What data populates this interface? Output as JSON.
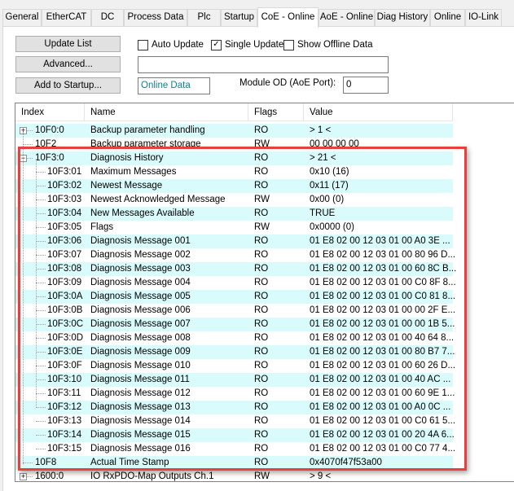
{
  "tabs": [
    {
      "label": "General",
      "active": false
    },
    {
      "label": "EtherCAT",
      "active": false
    },
    {
      "label": "DC",
      "active": false
    },
    {
      "label": "Process Data",
      "active": false
    },
    {
      "label": "Plc",
      "active": false
    },
    {
      "label": "Startup",
      "active": false
    },
    {
      "label": "CoE - Online",
      "active": true
    },
    {
      "label": "AoE - Online",
      "active": false
    },
    {
      "label": "Diag History",
      "active": false
    },
    {
      "label": "Online",
      "active": false
    },
    {
      "label": "IO-Link",
      "active": false
    }
  ],
  "toolbar": {
    "update_list": "Update List",
    "advanced": "Advanced...",
    "add_to_startup": "Add to Startup...",
    "auto_update": {
      "label": "Auto Update",
      "checked": false
    },
    "single_update": {
      "label": "Single Update",
      "checked": true
    },
    "show_offline": {
      "label": "Show Offline Data",
      "checked": false
    },
    "filter_value": "",
    "data_source": "Online Data",
    "module_od_label": "Module OD (AoE Port):",
    "module_od_value": "0"
  },
  "table": {
    "columns": [
      "Index",
      "Name",
      "Flags",
      "Value"
    ],
    "rows": [
      {
        "index": "10F0:0",
        "name": "Backup parameter handling",
        "flags": "RO",
        "value": "> 1 <",
        "level": 0,
        "expander": "+"
      },
      {
        "index": "10F2",
        "name": "Backup parameter storage",
        "flags": "RW",
        "value": "00 00 00 00",
        "level": 0,
        "expander": ""
      },
      {
        "index": "10F3:0",
        "name": "Diagnosis History",
        "flags": "RO",
        "value": "> 21 <",
        "level": 0,
        "expander": "-"
      },
      {
        "index": "10F3:01",
        "name": "Maximum Messages",
        "flags": "RO",
        "value": "0x10 (16)",
        "level": 1,
        "expander": ""
      },
      {
        "index": "10F3:02",
        "name": "Newest Message",
        "flags": "RO",
        "value": "0x11 (17)",
        "level": 1,
        "expander": ""
      },
      {
        "index": "10F3:03",
        "name": "Newest Acknowledged Message",
        "flags": "RW",
        "value": "0x00 (0)",
        "level": 1,
        "expander": ""
      },
      {
        "index": "10F3:04",
        "name": "New Messages Available",
        "flags": "RO",
        "value": "TRUE",
        "level": 1,
        "expander": ""
      },
      {
        "index": "10F3:05",
        "name": "Flags",
        "flags": "RW",
        "value": "0x0000 (0)",
        "level": 1,
        "expander": ""
      },
      {
        "index": "10F3:06",
        "name": "Diagnosis Message 001",
        "flags": "RO",
        "value": "01 E8 02 00 12 03 01 00 A0 3E ...",
        "level": 1,
        "expander": ""
      },
      {
        "index": "10F3:07",
        "name": "Diagnosis Message 002",
        "flags": "RO",
        "value": "01 E8 02 00 12 03 01 00 80 96 D...",
        "level": 1,
        "expander": ""
      },
      {
        "index": "10F3:08",
        "name": "Diagnosis Message 003",
        "flags": "RO",
        "value": "01 E8 02 00 12 03 01 00 60 8C B...",
        "level": 1,
        "expander": ""
      },
      {
        "index": "10F3:09",
        "name": "Diagnosis Message 004",
        "flags": "RO",
        "value": "01 E8 02 00 12 03 01 00 C0 8F 8...",
        "level": 1,
        "expander": ""
      },
      {
        "index": "10F3:0A",
        "name": "Diagnosis Message 005",
        "flags": "RO",
        "value": "01 E8 02 00 12 03 01 00 C0 81 8...",
        "level": 1,
        "expander": ""
      },
      {
        "index": "10F3:0B",
        "name": "Diagnosis Message 006",
        "flags": "RO",
        "value": "01 E8 02 00 12 03 01 00 00 2F E...",
        "level": 1,
        "expander": ""
      },
      {
        "index": "10F3:0C",
        "name": "Diagnosis Message 007",
        "flags": "RO",
        "value": "01 E8 02 00 12 03 01 00 00 1B 5...",
        "level": 1,
        "expander": ""
      },
      {
        "index": "10F3:0D",
        "name": "Diagnosis Message 008",
        "flags": "RO",
        "value": "01 E8 02 00 12 03 01 00 40 64 8...",
        "level": 1,
        "expander": ""
      },
      {
        "index": "10F3:0E",
        "name": "Diagnosis Message 009",
        "flags": "RO",
        "value": "01 E8 02 00 12 03 01 00 80 B7 7...",
        "level": 1,
        "expander": ""
      },
      {
        "index": "10F3:0F",
        "name": "Diagnosis Message 010",
        "flags": "RO",
        "value": "01 E8 02 00 12 03 01 00 60 26 D...",
        "level": 1,
        "expander": ""
      },
      {
        "index": "10F3:10",
        "name": "Diagnosis Message 011",
        "flags": "RO",
        "value": "01 E8 02 00 12 03 01 00 40 AC ...",
        "level": 1,
        "expander": ""
      },
      {
        "index": "10F3:11",
        "name": "Diagnosis Message 012",
        "flags": "RO",
        "value": "01 E8 02 00 12 03 01 00 60 9E 1...",
        "level": 1,
        "expander": ""
      },
      {
        "index": "10F3:12",
        "name": "Diagnosis Message 013",
        "flags": "RO",
        "value": "01 E8 02 00 12 03 01 00 A0 0C ...",
        "level": 1,
        "expander": ""
      },
      {
        "index": "10F3:13",
        "name": "Diagnosis Message 014",
        "flags": "RO",
        "value": "01 E8 02 00 12 03 01 00 C0 61 5...",
        "level": 1,
        "expander": ""
      },
      {
        "index": "10F3:14",
        "name": "Diagnosis Message 015",
        "flags": "RO",
        "value": "01 E8 02 00 12 03 01 00 20 4A 6...",
        "level": 1,
        "expander": ""
      },
      {
        "index": "10F3:15",
        "name": "Diagnosis Message 016",
        "flags": "RO",
        "value": "01 E8 02 00 12 03 01 00 C0 77 4...",
        "level": 1,
        "expander": ""
      },
      {
        "index": "10F8",
        "name": "Actual Time Stamp",
        "flags": "RO",
        "value": "0x4070f47f53a00",
        "level": 0,
        "expander": ""
      },
      {
        "index": "1600:0",
        "name": "IO RxPDO-Map Outputs Ch.1",
        "flags": "RW",
        "value": "> 9 <",
        "level": 0,
        "expander": "+"
      }
    ]
  },
  "colors": {
    "row_alt": "#d9fbfb",
    "highlight_border": "#e8403f",
    "data_source_text": "#0f7f8f"
  }
}
